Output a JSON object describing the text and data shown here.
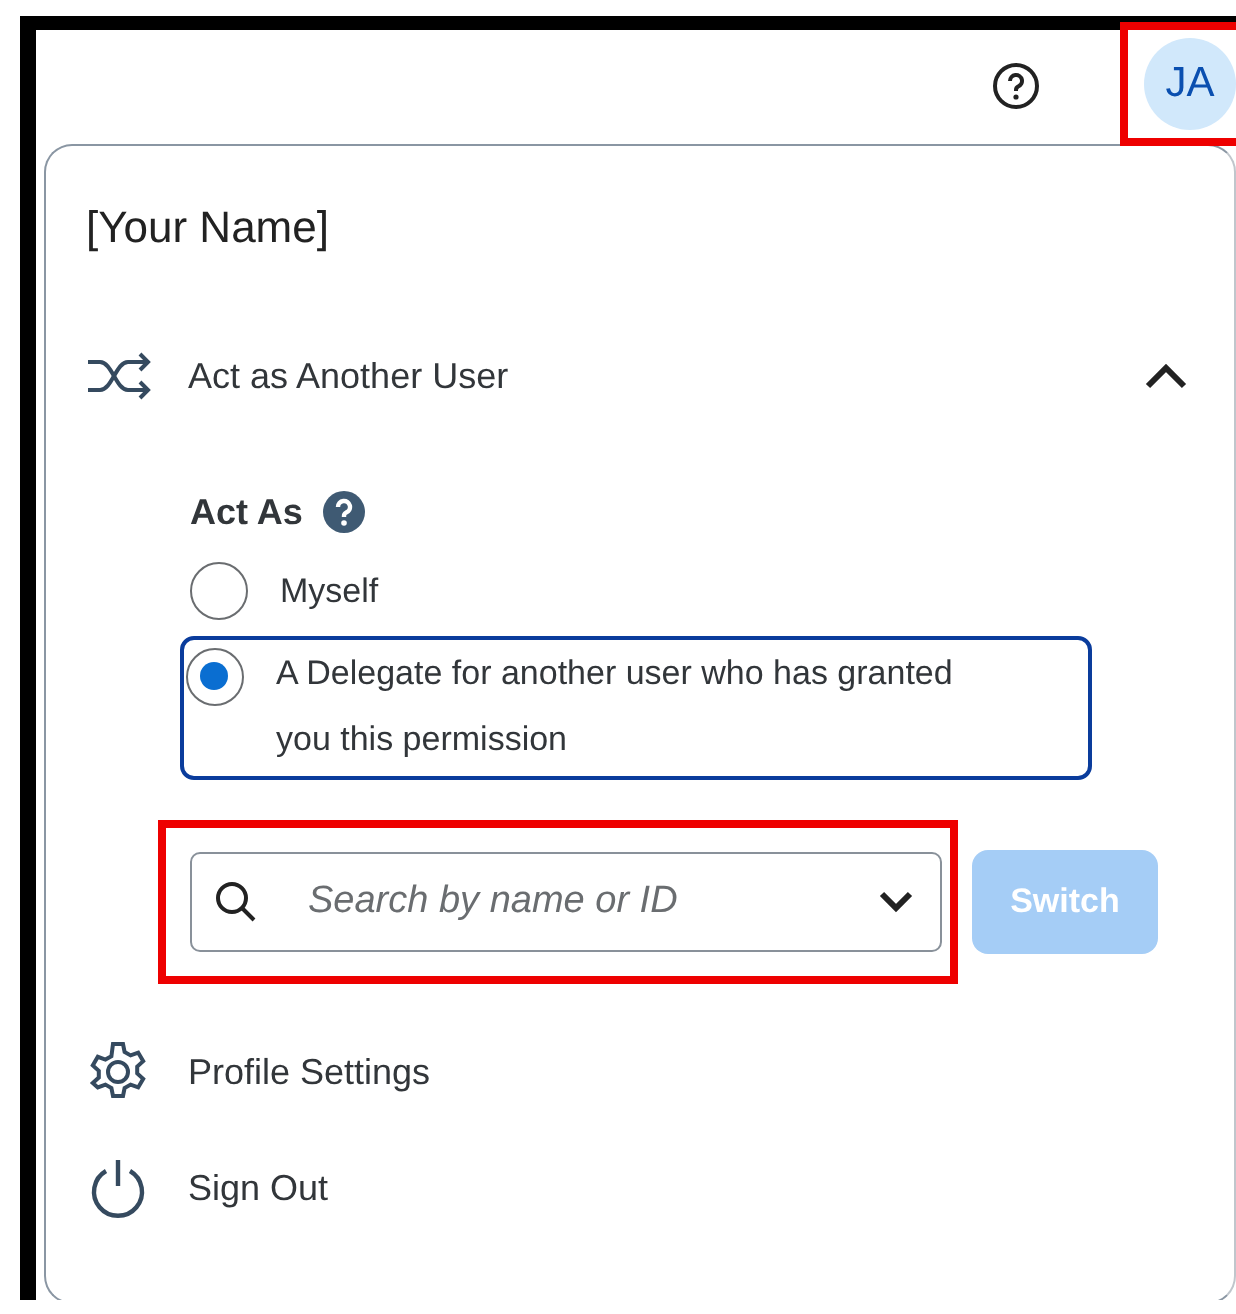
{
  "header": {
    "avatar": {
      "initials": "JA"
    }
  },
  "menu": {
    "user_name": "[Your Name]",
    "act_as_section": {
      "label": "Act as Another User",
      "expanded": true,
      "title": "Act As",
      "options": [
        {
          "label": "Myself",
          "selected": false
        },
        {
          "label": "A Delegate for another user who has granted you this permission",
          "selected": true
        }
      ],
      "search": {
        "placeholder": "Search by name or ID"
      },
      "switch_button": {
        "label": "Switch",
        "disabled": true
      }
    },
    "items": [
      {
        "kind": "settings",
        "label": "Profile Settings"
      },
      {
        "kind": "signout",
        "label": "Sign Out"
      }
    ]
  }
}
